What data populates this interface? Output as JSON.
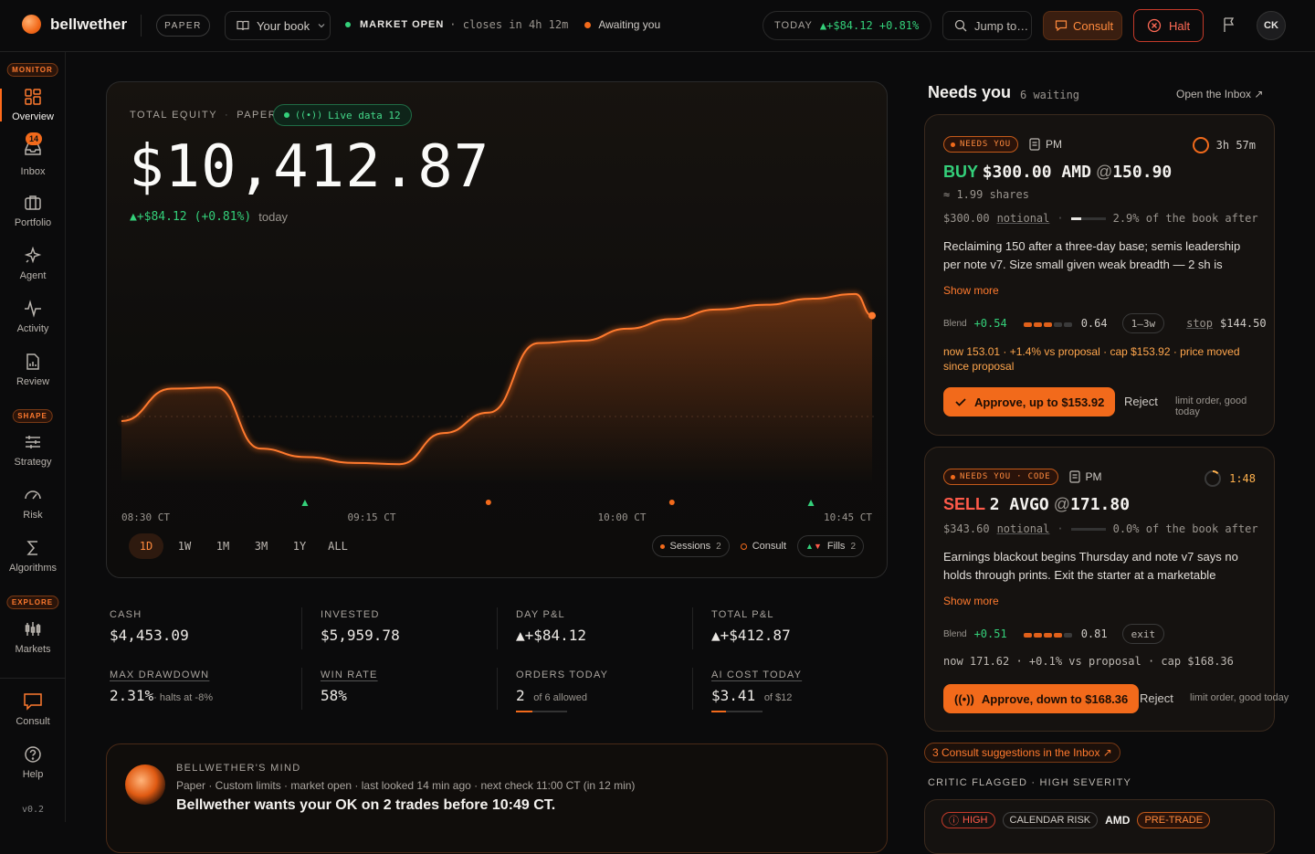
{
  "topbar": {
    "brand": "bellwether",
    "mode": "PAPER",
    "book": "Your book",
    "market": "MARKET OPEN",
    "closes": "· closes in 4h 12m",
    "awaiting": "Awaiting you",
    "today_label": "TODAY",
    "today_value": "▲+$84.12 +0.81%",
    "jump": "Jump to…",
    "consult": "Consult",
    "halt": "Halt",
    "avatar": "CK",
    "icons": [
      "book-icon",
      "chevron-down-icon",
      "search-icon",
      "chat-icon",
      "halt-icon",
      "flag-icon"
    ]
  },
  "sidebar": {
    "monitor_tag": "MONITOR",
    "shape_tag": "SHAPE",
    "explore_tag": "EXPLORE",
    "inbox_badge": "14",
    "items": [
      {
        "label": "Overview"
      },
      {
        "label": "Inbox"
      },
      {
        "label": "Portfolio"
      },
      {
        "label": "Agent"
      },
      {
        "label": "Activity"
      },
      {
        "label": "Review"
      },
      {
        "label": "Strategy"
      },
      {
        "label": "Risk"
      },
      {
        "label": "Algorithms"
      },
      {
        "label": "Markets"
      },
      {
        "label": "Consult"
      },
      {
        "label": "Help"
      }
    ],
    "version": "v0.2"
  },
  "equity": {
    "label": "TOTAL EQUITY",
    "mode": "PAPER",
    "live": "Live data 12",
    "value": "$10,412.87",
    "change": "▲+$84.12",
    "pct": "(+0.81%)",
    "period": "today",
    "ranges": [
      "1D",
      "1W",
      "1M",
      "3M",
      "1Y",
      "ALL"
    ],
    "legend_sessions": "Sessions",
    "legend_sessions_n": "2",
    "legend_consult": "Consult",
    "legend_fills": "Fills",
    "legend_fills_n": "2"
  },
  "chart_data": {
    "type": "line",
    "title": "",
    "x_ticks": [
      "08:30 CT",
      "09:15 CT",
      "10:00 CT",
      "10:45 CT"
    ],
    "x_range_minutes": [
      0,
      135
    ],
    "y_baseline": 10328.75,
    "series": [
      {
        "values_x_min": [
          0,
          9,
          17,
          25,
          33,
          42,
          50,
          58,
          66,
          75,
          83,
          91,
          99,
          107,
          116,
          124,
          132,
          135
        ],
        "values_y": [
          10325,
          10352,
          10353,
          10302,
          10295,
          10290,
          10289,
          10315,
          10332,
          10390,
          10392,
          10402,
          10410,
          10418,
          10422,
          10427,
          10431,
          10412.87
        ]
      }
    ],
    "markers": [
      {
        "x_min": 33,
        "kind": "fill-buy",
        "color": "#34d07a"
      },
      {
        "x_min": 66,
        "kind": "consult",
        "color": "#f26a1b"
      },
      {
        "x_min": 99,
        "kind": "consult",
        "color": "#f26a1b"
      },
      {
        "x_min": 124,
        "kind": "fill-buy",
        "color": "#34d07a"
      }
    ],
    "line_color": "#f26a1b"
  },
  "stats": {
    "cash_l": "CASH",
    "cash_v": "$4,453.09",
    "inv_l": "INVESTED",
    "inv_v": "$5,959.78",
    "day_l": "DAY P&L",
    "day_v": "▲+$84.12",
    "tot_l": "TOTAL P&L",
    "tot_v": "▲+$412.87",
    "dd_l": "MAX DRAWDOWN",
    "dd_v": "2.31%",
    "dd_s": "· halts at -8%",
    "wr_l": "WIN RATE",
    "wr_v": "58%",
    "ord_l": "ORDERS TODAY",
    "ord_v": "2",
    "ord_s": "of 6 allowed",
    "ord_frac": 0.33,
    "ai_l": "AI COST TODAY",
    "ai_v": "$3.41",
    "ai_s": "of $12",
    "ai_frac": 0.28
  },
  "mind": {
    "title": "BELLWETHER'S MIND",
    "meta": "Paper · Custom limits · market open · last looked 14 min ago · next check 11:00 CT (in 12 min)",
    "headline": "Bellwether wants your OK on 2 trades before 10:49 CT."
  },
  "needs": {
    "title": "Needs you",
    "waiting": "6 waiting",
    "open": "Open the Inbox ↗",
    "cards": [
      {
        "tag": "NEEDS YOU",
        "who": "PM",
        "timer": "3h 57m",
        "side": "BUY",
        "amount": "$300.00 AMD",
        "at": "@",
        "price": "150.90",
        "shares": "≈ 1.99 shares",
        "notional": "$300.00",
        "notional_l": "notional",
        "after": "2.9% of the book after",
        "after_frac": 0.29,
        "body": "Reclaiming 150 after a three-day base; semis leadership per note v7. Size small given weak breadth — 2 sh is",
        "more": "Show more",
        "blend_l": "Blend",
        "blend": "+0.54",
        "conf": "0.64",
        "horizon": "1–3w",
        "stop_l": "stop",
        "stop": "$144.50",
        "warn": "now 153.01 · +1.4% vs proposal · cap $153.92 · price moved since proposal",
        "approve": "Approve, up to $153.92",
        "reject": "Reject",
        "note": "limit order, good today"
      },
      {
        "tag": "NEEDS YOU · CODE",
        "who": "PM",
        "timer": "1:48",
        "side": "SELL",
        "amount": "2 AVGO",
        "at": "@",
        "price": "171.80",
        "notional": "$343.60",
        "notional_l": "notional",
        "after": "0.0% of the book after",
        "after_frac": 0,
        "body": "Earnings blackout begins Thursday and note v7 says no holds through prints. Exit the starter at a marketable",
        "more": "Show more",
        "blend_l": "Blend",
        "blend": "+0.51",
        "conf": "0.81",
        "horizon": "exit",
        "warn": "now 171.62 · +0.1% vs proposal · cap $168.36",
        "approve": "Approve, down to $168.36",
        "reject": "Reject",
        "note": "limit order, good today"
      }
    ],
    "suggest": "3 Consult suggestions in the Inbox ↗",
    "critic": "CRITIC FLAGGED · HIGH SEVERITY",
    "critic_tags": [
      "HIGH",
      "CALENDAR RISK",
      "AMD",
      "PRE-TRADE"
    ]
  }
}
